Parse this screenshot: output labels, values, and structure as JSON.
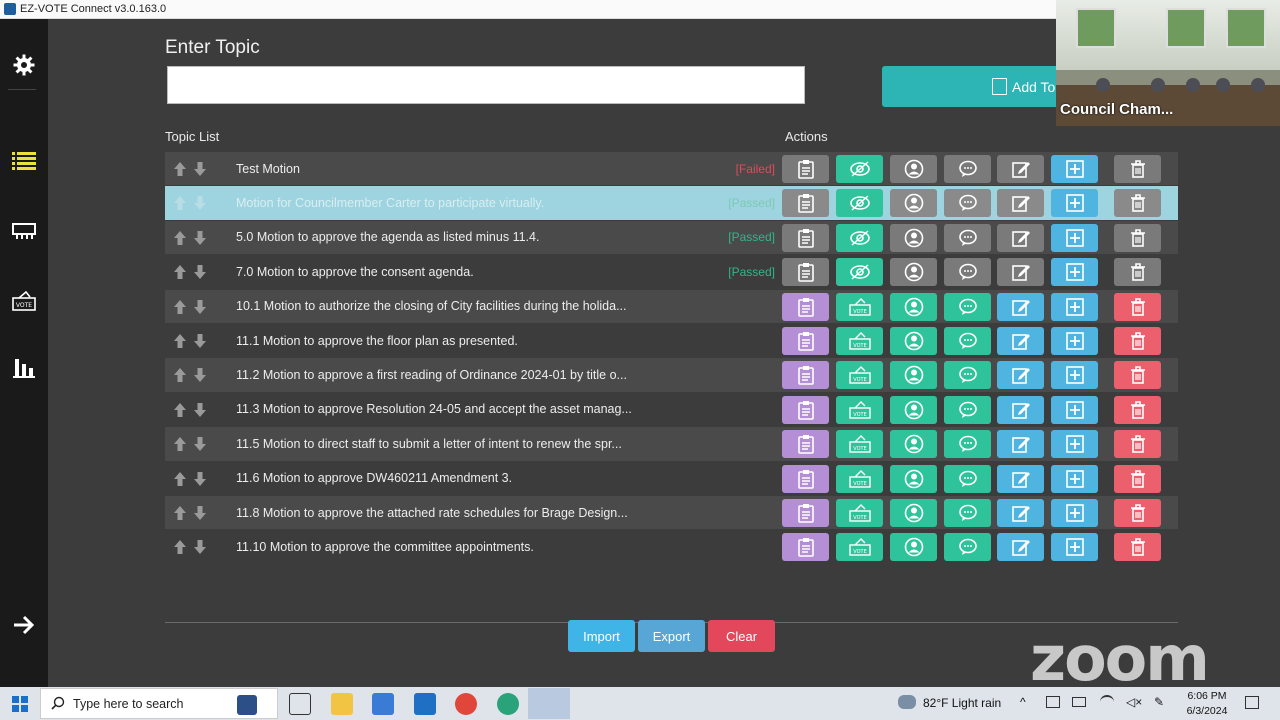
{
  "window": {
    "title": "EZ-VOTE Connect v3.0.163.0"
  },
  "header": {
    "enter_topic_label": "Enter Topic",
    "topic_input_value": "",
    "add_button_label": "Add To"
  },
  "list": {
    "topic_list_label": "Topic List",
    "actions_label": "Actions",
    "rows": [
      {
        "text": "Test Motion",
        "status": "[Failed]"
      },
      {
        "text": "Motion for Councilmember Carter to participate virtually.",
        "status": "[Passed]"
      },
      {
        "text": "5.0 Motion to approve the agenda as listed minus 11.4.",
        "status": "[Passed]"
      },
      {
        "text": "7.0 Motion to approve the consent agenda.",
        "status": "[Passed]"
      },
      {
        "text": "10.1 Motion to authorize the closing of City facilities during the holida...",
        "status": ""
      },
      {
        "text": "11.1 Motion to approve the floor plan as presented.",
        "status": ""
      },
      {
        "text": "11.2 Motion to approve a first reading of Ordinance 2024-01 by title o...",
        "status": ""
      },
      {
        "text": "11.3 Motion to approve Resolution 24-05 and accept the asset manag...",
        "status": ""
      },
      {
        "text": "11.5 Motion to direct staff to submit a letter of intent to renew the spr...",
        "status": ""
      },
      {
        "text": "11.6 Motion to approve DW460211 Amendment 3.",
        "status": ""
      },
      {
        "text": "11.8 Motion to approve the attached rate schedules for Brage Design...",
        "status": ""
      },
      {
        "text": "11.10 Motion to approve the committee appointments.",
        "status": ""
      }
    ]
  },
  "footer": {
    "import_label": "Import",
    "export_label": "Export",
    "clear_label": "Clear"
  },
  "video": {
    "caption": "Council Cham..."
  },
  "zoom_logo": "zoom",
  "taskbar": {
    "search_placeholder": "Type here to search",
    "weather": "82°F  Light rain",
    "time": "6:06 PM",
    "date": "6/3/2024"
  },
  "colors": {
    "grey": "#7a7a7a",
    "purple": "#b58fd6",
    "teal": "#2ec39a",
    "blue": "#4fb4e0",
    "red": "#ec5f6c",
    "selected_row": "#9ed4df"
  }
}
